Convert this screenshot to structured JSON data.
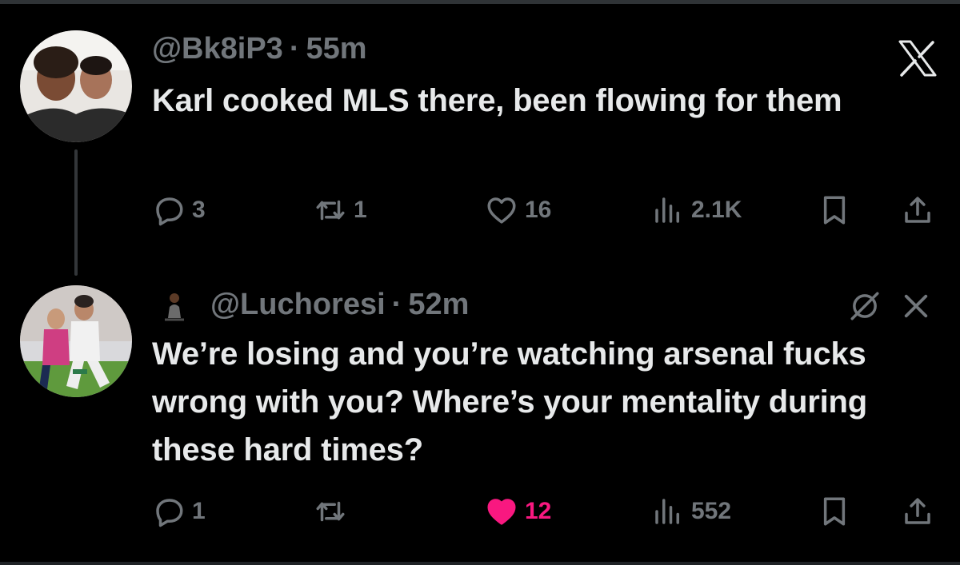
{
  "tweets": [
    {
      "handle": "@Bk8iP3",
      "time": "55m",
      "text": "Karl cooked MLS there, been flowing for them",
      "replies": "3",
      "reposts": "1",
      "likes": "16",
      "views": "2.1K",
      "liked": false
    },
    {
      "handle": "@Luchoresi",
      "time": "52m",
      "text": "We’re losing and you’re watching arsenal fucks wrong with you?  Where’s your mentality during these hard times?",
      "replies": "1",
      "reposts": "",
      "likes": "12",
      "views": "552",
      "liked": true
    }
  ],
  "separator": "·",
  "colors": {
    "background": "#000000",
    "text": "#e7e9ea",
    "muted": "#71767b",
    "like_active": "#f91880"
  },
  "icons": [
    "x-logo-icon",
    "reply-icon",
    "repost-icon",
    "like-icon",
    "views-icon",
    "bookmark-icon",
    "share-icon",
    "mute-icon",
    "close-icon"
  ]
}
